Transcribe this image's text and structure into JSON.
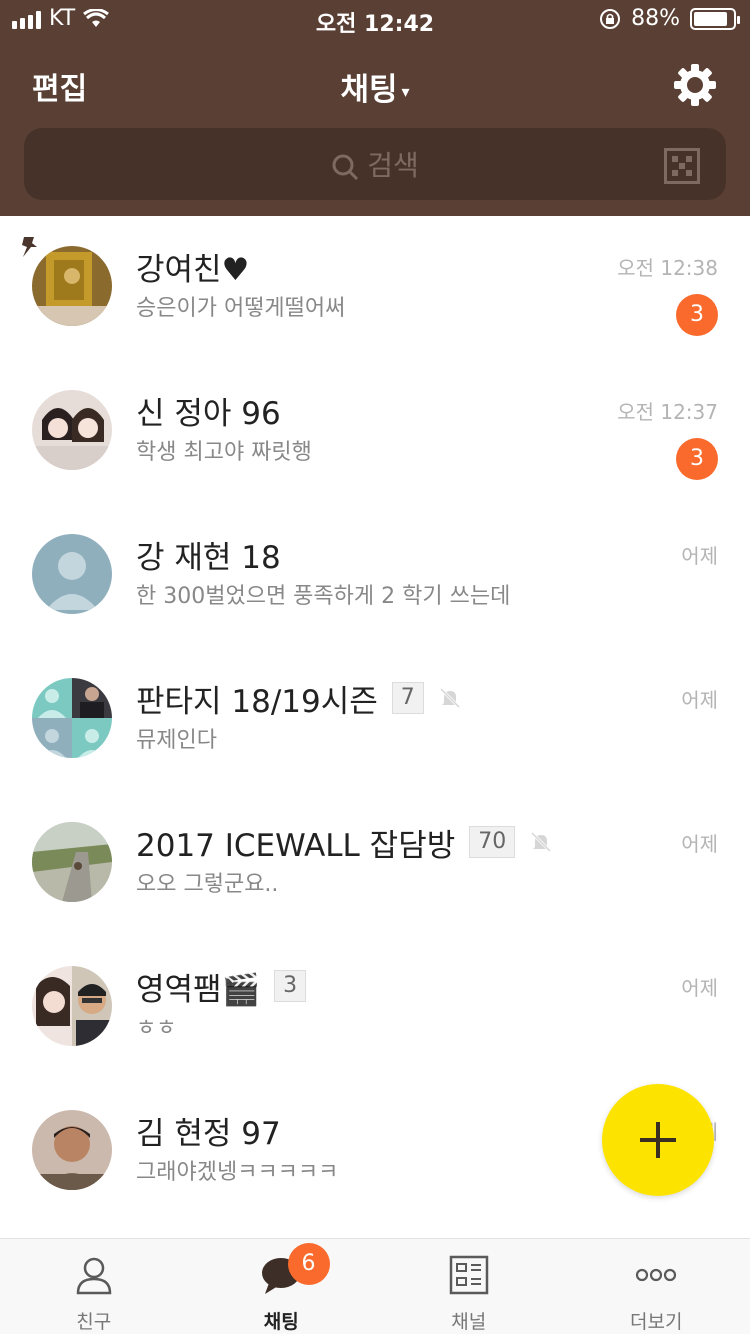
{
  "status_bar": {
    "carrier": "KT",
    "time": "오전 12:42",
    "battery": "88%",
    "battery_level": 0.88
  },
  "header": {
    "edit_label": "편집",
    "title": "채팅",
    "title_caret": "▾"
  },
  "search": {
    "placeholder": "검색"
  },
  "chats": [
    {
      "name": "강여친♥",
      "preview": "승은이가 어떻게떨어써",
      "time": "오전 12:38",
      "unread": "3",
      "pinned": true,
      "count": "",
      "muted": false
    },
    {
      "name": "신 정아 96",
      "preview": "학생 최고야 짜릿행",
      "time": "오전 12:37",
      "unread": "3",
      "pinned": false,
      "count": "",
      "muted": false
    },
    {
      "name": "강 재현 18",
      "preview": "한 300벌었으면 풍족하게 2 학기 쓰는데",
      "time": "어제",
      "unread": "",
      "count": "",
      "muted": false
    },
    {
      "name": "판타지 18/19시즌",
      "preview": "뮤제인다",
      "time": "어제",
      "unread": "",
      "count": "7",
      "muted": true
    },
    {
      "name": "2017 ICEWALL 잡담방",
      "preview": "오오 그렇군요..",
      "time": "어제",
      "unread": "",
      "count": "70",
      "muted": true
    },
    {
      "name": "영역팸🎬",
      "preview": "ㅎㅎ",
      "time": "어제",
      "unread": "",
      "count": "3",
      "muted": false
    },
    {
      "name": "김 현정 97",
      "preview": "그래야겠넹ㅋㅋㅋㅋㅋ",
      "time": "어제",
      "unread": "",
      "count": "",
      "muted": false
    }
  ],
  "tabs": [
    {
      "label": "친구",
      "icon": "person-icon"
    },
    {
      "label": "채팅",
      "icon": "chat-bubble-icon",
      "badge": "6",
      "active": true
    },
    {
      "label": "채널",
      "icon": "channel-icon"
    },
    {
      "label": "더보기",
      "icon": "more-icon"
    }
  ],
  "colors": {
    "header": "#5a4034",
    "badge": "#f96a2c",
    "fab": "#fde400"
  }
}
